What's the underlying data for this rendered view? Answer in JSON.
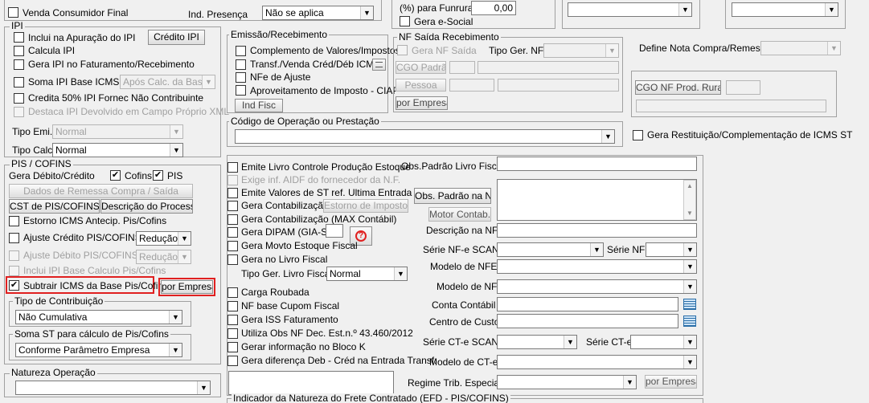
{
  "top": {
    "venda_consumidor_final": "Venda Consumidor Final",
    "ind_presenca_label": "Ind. Presença",
    "ind_presenca_value": "Não se aplica",
    "funrural_label": "(%) para Funrural",
    "funrural_value": "0,00",
    "gera_esocial": "Gera e-Social"
  },
  "ipi": {
    "title": "IPI",
    "inclui_apuracao": "Inclui na Apuração do IPI",
    "credito_ipi_button": "Crédito IPI",
    "calcula_ipi": "Calcula IPI",
    "gera_ipi_faturamento": "Gera IPI no Faturamento/Recebimento",
    "soma_ipi_base_icms": "Soma IPI Base ICMS",
    "soma_ipi_base_icms_value": "Após Calc. da Base",
    "credita_50": "Credita 50% IPI Fornec Não Contribuinte",
    "destaca_ipi_devolvido": "Destaca IPI Devolvido em Campo Próprio XML",
    "tipo_emi_label": "Tipo Emi.",
    "tipo_emi_value": "Normal",
    "tipo_calc_label": "Tipo Calc.",
    "tipo_calc_value": "Normal"
  },
  "pis_cofins": {
    "title": "PIS / COFINS",
    "gera_debito_credito": "Gera Débito/Crédito",
    "cofins": "Cofins",
    "pis": "PIS",
    "dados_remessa_button": "Dados de Remessa Compra / Saída",
    "cst_button": "CST de PIS/COFINS",
    "descricao_processo_button": "Descrição do Processo",
    "estorno_icms_antecip": "Estorno ICMS Antecip. Pis/Cofins",
    "ajuste_credito": "Ajuste Crédito PIS/COFINS",
    "ajuste_credito_value": "Redução",
    "ajuste_debito": "Ajuste Débito PIS/COFINS",
    "ajuste_debito_value": "Redução",
    "inclui_ipi_base": "Inclui IPI Base Calculo Pis/Cofins",
    "subtrair_icms": "Subtrair ICMS da Base Pis/Cofins",
    "por_empresa_button": "por Empresa"
  },
  "tipo_contribuicao": {
    "title": "Tipo de Contribuição",
    "value": "Não Cumulativa"
  },
  "soma_st": {
    "title": "Soma ST para cálculo de Pis/Cofins",
    "value": "Conforme Parâmetro Empresa"
  },
  "natureza_operacao": {
    "title": "Natureza Operação"
  },
  "emissao": {
    "title": "Emissão/Recebimento",
    "complemento": "Complemento de Valores/Impostos",
    "transf_venda": "Transf./Venda Créd/Déb ICMS",
    "nfe_ajuste": "NFe de Ajuste",
    "aproveitamento_ciap": "Aproveitamento de Imposto - CIAP",
    "ind_fisc_button": "Ind Fisc"
  },
  "nf_saida": {
    "title": "NF Saída Recebimento",
    "gera_nf_saida": "Gera NF Saída",
    "tipo_ger_nf_label": "Tipo Ger. NF",
    "cgo_padrao_button": "CGO Padrão",
    "pessoa_button": "Pessoa",
    "por_empresa_button": "por Empresa"
  },
  "define_nota": {
    "label": "Define Nota Compra/Remessa",
    "cgo_nf_prod_rural_button": "CGO NF Prod. Rural"
  },
  "cfop": {
    "title": "Código de Operação ou Prestação"
  },
  "gera_restituicao": "Gera Restituição/Complementação de ICMS ST",
  "opcoes": {
    "emite_livro": "Emite Livro Controle Produção Estoque",
    "exige_aidf": "Exige inf. AIDF do fornecedor da N.F.",
    "emite_valores_st": "Emite Valores de ST ref. Ultima Entrada",
    "gera_contabilizacao": "Gera Contabilização",
    "estorno_impostos_button": "Estorno de Impostos",
    "gera_contabilizacao_max": "Gera Contabilização (MAX Contábil)",
    "gera_dipam": "Gera DIPAM (GIA-SP",
    "gera_movto_estoque": "Gera Movto Estoque Fiscal",
    "gera_livro_fiscal": "Gera no Livro Fiscal",
    "tipo_ger_livro_label": "Tipo Ger. Livro Fiscal",
    "tipo_ger_livro_value": "Normal",
    "carga_roubada": "Carga Roubada",
    "nf_base_cupom": "NF base Cupom Fiscal",
    "gera_iss": "Gera ISS Faturamento",
    "utiliza_obs_nf": "Utiliza Obs NF Dec. Est.n.º 43.460/2012",
    "gerar_bloco_k": "Gerar informação no Bloco K",
    "gera_diferenca": "Gera diferença Deb - Créd na Entrada Transf."
  },
  "campos": {
    "obs_padrao_livro": "Obs.Padrão Livro Fiscal",
    "obs_padrao_nf_button": "Obs. Padrão na NF",
    "motor_contab_button": "Motor Contab.",
    "descricao_nf": "Descrição na NF",
    "serie_nfe_scan": "Série NF-e SCAN",
    "serie_nf": "Série NF",
    "modelo_nfe": "Modelo de NFE",
    "modelo_nf": "Modelo de NF",
    "conta_contabil": "Conta Contábil",
    "centro_custo": "Centro de Custo",
    "serie_cte_scan": "Série CT-e SCAN",
    "serie_cte": "Série CT-e",
    "modelo_cte": "Modelo de CT-e",
    "regime_trib": "Regime Trib. Especial",
    "por_empresa_button": "por Empresa"
  },
  "indicador_frete": {
    "title": "Indicador da Natureza do Frete Contratado (EFD - PIS/COFINS)"
  }
}
